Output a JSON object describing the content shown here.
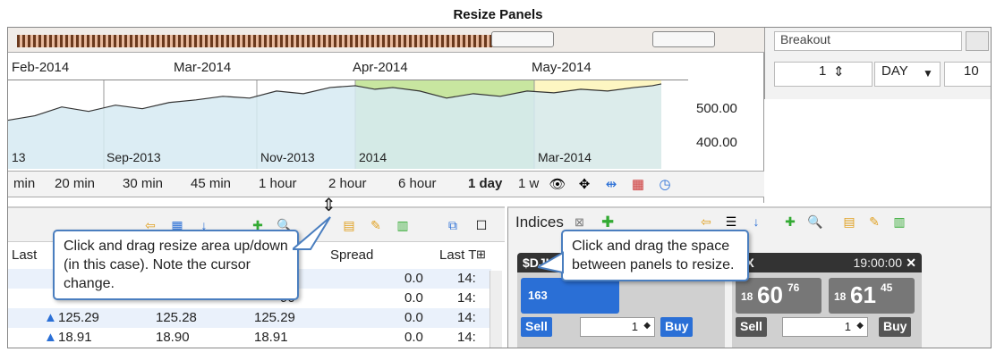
{
  "title": "Resize Panels",
  "chart": {
    "top_dates": [
      "Feb-2014",
      "Mar-2014",
      "Apr-2014",
      "May-2014"
    ],
    "bottom_dates": [
      "13",
      "Sep-2013",
      "Nov-2013",
      "2014",
      "Mar-2014"
    ],
    "y_labels": [
      "500.00",
      "400.00"
    ],
    "highlight_color": "#c8e6a0",
    "highlight_color2": "#fdf6c2",
    "fill_color": "#d6eaf2"
  },
  "timeframe_tabs": [
    "min",
    "20 min",
    "30 min",
    "45 min",
    "1 hour",
    "2 hour",
    "6 hour",
    "1 day",
    "1 w"
  ],
  "active_tab": "1 day",
  "right_top": {
    "input_value": "Breakout",
    "spinner_value": "1",
    "period": "DAY",
    "count": "10"
  },
  "table": {
    "headers": [
      "Last",
      "Spread",
      "Last T"
    ],
    "rows": [
      {
        "last": "",
        "bid": "",
        "ask": "23",
        "spread": "0.0",
        "time": "14:"
      },
      {
        "last": "",
        "bid": "",
        "ask": "90",
        "spread": "0.0",
        "time": "14:"
      },
      {
        "last": "125.29",
        "bid": "125.28",
        "ask": "125.29",
        "spread": "0.0",
        "time": "14:"
      },
      {
        "last": "18.91",
        "bid": "18.90",
        "ask": "18.91",
        "spread": "0.0",
        "time": "14:"
      }
    ]
  },
  "quotes": {
    "tab_label": "Indices",
    "card1": {
      "symbol": "$DJI",
      "price_small": "163",
      "sell": "Sell",
      "buy": "Buy",
      "qty": "1"
    },
    "card2": {
      "symbol": "PX",
      "time": "19:00:00",
      "bid_big": "60",
      "bid_prefix": "18",
      "bid_sup": "76",
      "ask_big": "61",
      "ask_prefix": "18",
      "ask_sup": "45",
      "sell": "Sell",
      "buy": "Buy",
      "qty": "1"
    }
  },
  "callouts": {
    "left": "Click and drag resize area up/down (in this case). Note the cursor change.",
    "right": "Click and drag the space between panels to resize."
  }
}
